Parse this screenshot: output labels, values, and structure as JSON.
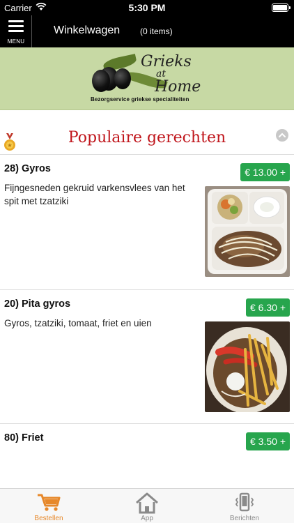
{
  "status_bar": {
    "carrier": "Carrier",
    "time": "5:30 PM"
  },
  "header": {
    "menu_label": "MENU",
    "title": "Winkelwagen",
    "item_count": "(0 items)"
  },
  "banner": {
    "brand_line1": "Grieks",
    "brand_line2": "at",
    "brand_line3": "Home",
    "tagline": "Bezorgservice griekse specialiteiten"
  },
  "section": {
    "title": "Populaire gerechten"
  },
  "dishes": [
    {
      "name": "28)  Gyros",
      "description": "Fijngesneden gekruid varkensvlees van het spit met tzatziki",
      "price": "€ 13.00 +"
    },
    {
      "name": "20)  Pita gyros",
      "description": "Gyros, tzatziki, tomaat, friet en uien",
      "price": "€ 6.30 +"
    },
    {
      "name": "80)  Friet",
      "description": "",
      "price": "€ 3.50 +"
    }
  ],
  "tabs": [
    {
      "label": "Bestellen",
      "icon": "cart-icon",
      "active": true
    },
    {
      "label": "App",
      "icon": "home-icon",
      "active": false
    },
    {
      "label": "Berichten",
      "icon": "phone-vibrate-icon",
      "active": false
    }
  ],
  "colors": {
    "accent": "#e7882a",
    "price_green": "#27a54d",
    "title_red": "#c0161c",
    "banner_green": "#c7d9a4"
  }
}
